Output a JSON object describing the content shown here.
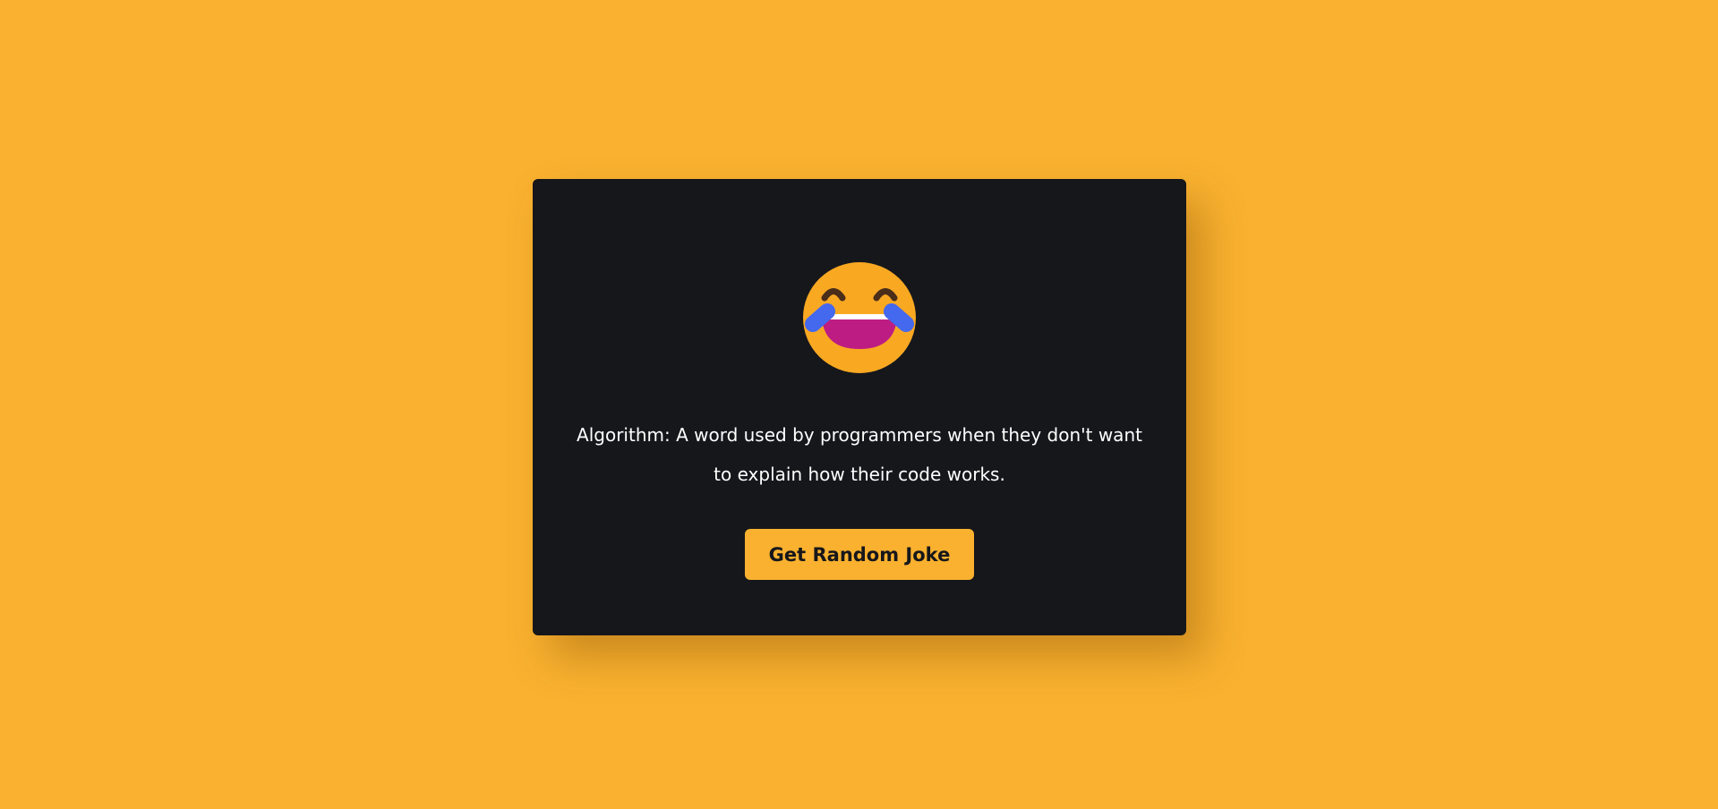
{
  "colors": {
    "background": "#f9b12f",
    "card": "#16171b",
    "button": "#f9b12f",
    "button_text": "#16171b",
    "text": "#ffffff"
  },
  "emoji": {
    "icon": "laughing-tears-emoji-icon"
  },
  "joke": {
    "text": "Algorithm: A word used by programmers when they don't want to explain how their code works."
  },
  "button": {
    "label": "Get Random Joke"
  }
}
